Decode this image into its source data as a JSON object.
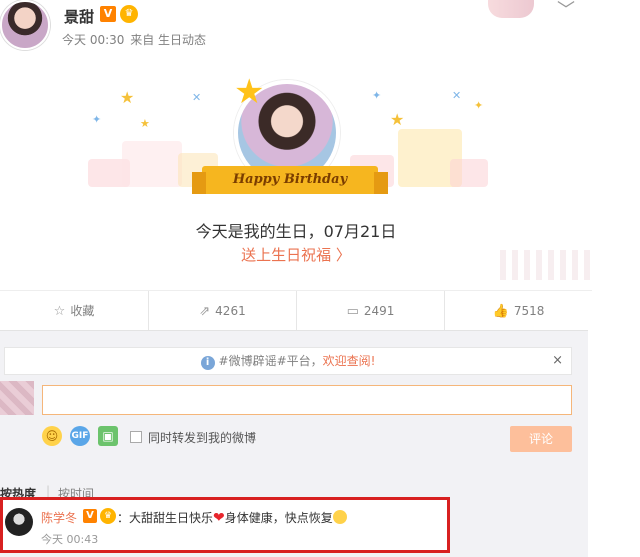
{
  "header": {
    "username": "景甜",
    "v_badge": "V",
    "level_badge": "♛",
    "time": "今天 00:30",
    "source": "来自 生日动态",
    "menu_chevron": "chevron-down-icon"
  },
  "birthday_card": {
    "ribbon_text": "Happy Birthday",
    "message": "今天是我的生日，07月21日",
    "wish_link": "送上生日祝福 〉"
  },
  "actions": [
    {
      "icon": "star-icon",
      "glyph": "☆",
      "label": "收藏"
    },
    {
      "icon": "repost-icon",
      "glyph": "⇗",
      "label": "4261"
    },
    {
      "icon": "comment-icon",
      "glyph": "▭",
      "label": "2491"
    },
    {
      "icon": "like-icon",
      "glyph": "👍",
      "label": "7518"
    }
  ],
  "notice": {
    "info_glyph": "i",
    "pre": "#微博辟谣#平台，",
    "highlight": "欢迎查阅!",
    "close": "×"
  },
  "composer": {
    "input_value": "",
    "repost_label": "同时转发到我的微博",
    "submit_label": "评论",
    "emoji_glyph": "☺",
    "gif_glyph": "GIF",
    "image_glyph": "▣"
  },
  "sort": {
    "hot": "按热度",
    "separator": "|",
    "time": "按时间"
  },
  "comment": {
    "name": "陈学冬",
    "v_badge": "V",
    "level_badge": "♛",
    "text_before": "：大甜甜生日快乐",
    "heart": "❤",
    "text_after": "身体健康，快点恢复",
    "time": "今天 00:43"
  },
  "colors": {
    "accent_orange": "#eb7350",
    "badge_orange": "#ff8200",
    "ribbon_gold": "#f6b61f",
    "highlight_border": "#d82020",
    "submit_disabled": "#fdbf9b"
  }
}
